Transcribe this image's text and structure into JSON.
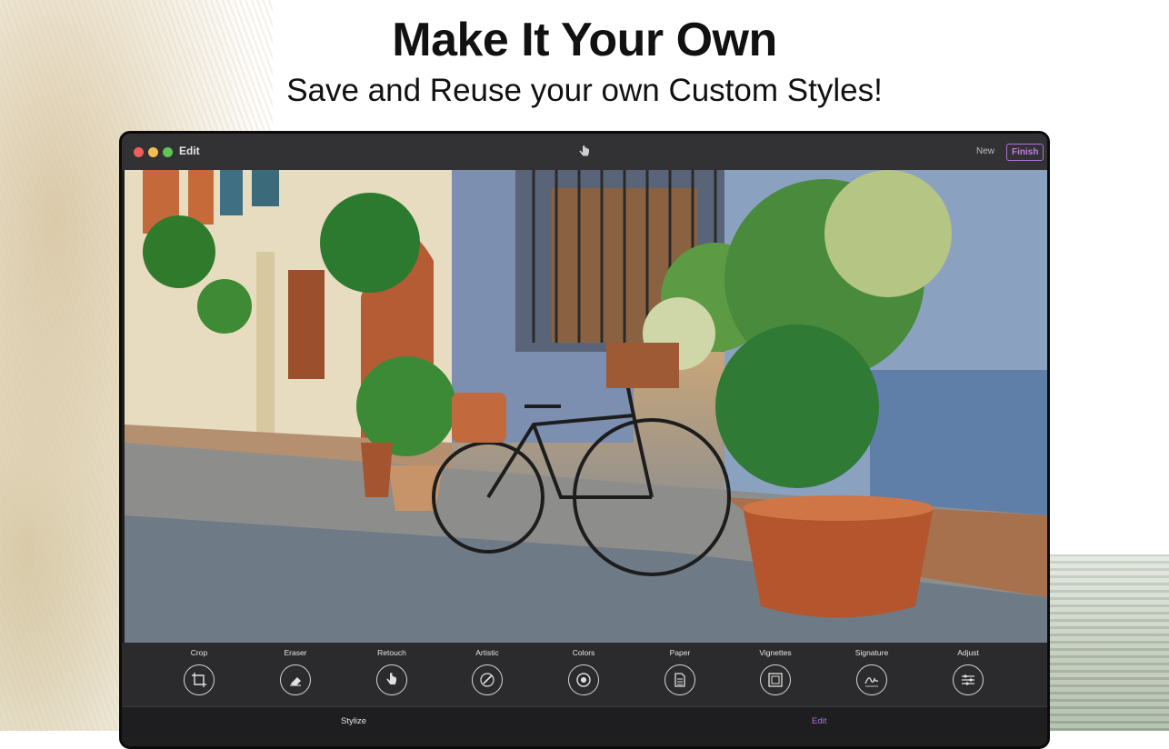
{
  "header": {
    "headline": "Make It Your Own",
    "subline": "Save and Reuse your own Custom Styles!"
  },
  "window": {
    "title": "Edit",
    "new_label": "New",
    "finish_label": "Finish",
    "accent_color": "#b070dc"
  },
  "tools": [
    {
      "label": "Crop",
      "icon": "crop-icon"
    },
    {
      "label": "Eraser",
      "icon": "eraser-icon"
    },
    {
      "label": "Retouch",
      "icon": "hand-touch-icon"
    },
    {
      "label": "Artistic",
      "icon": "brush-icon"
    },
    {
      "label": "Colors",
      "icon": "palette-icon"
    },
    {
      "label": "Paper",
      "icon": "paper-icon"
    },
    {
      "label": "Vignettes",
      "icon": "vignette-icon"
    },
    {
      "label": "Signature",
      "icon": "signature-icon"
    },
    {
      "label": "Adjust",
      "icon": "sliders-icon"
    }
  ],
  "tabs": {
    "stylize": "Stylize",
    "edit": "Edit"
  }
}
